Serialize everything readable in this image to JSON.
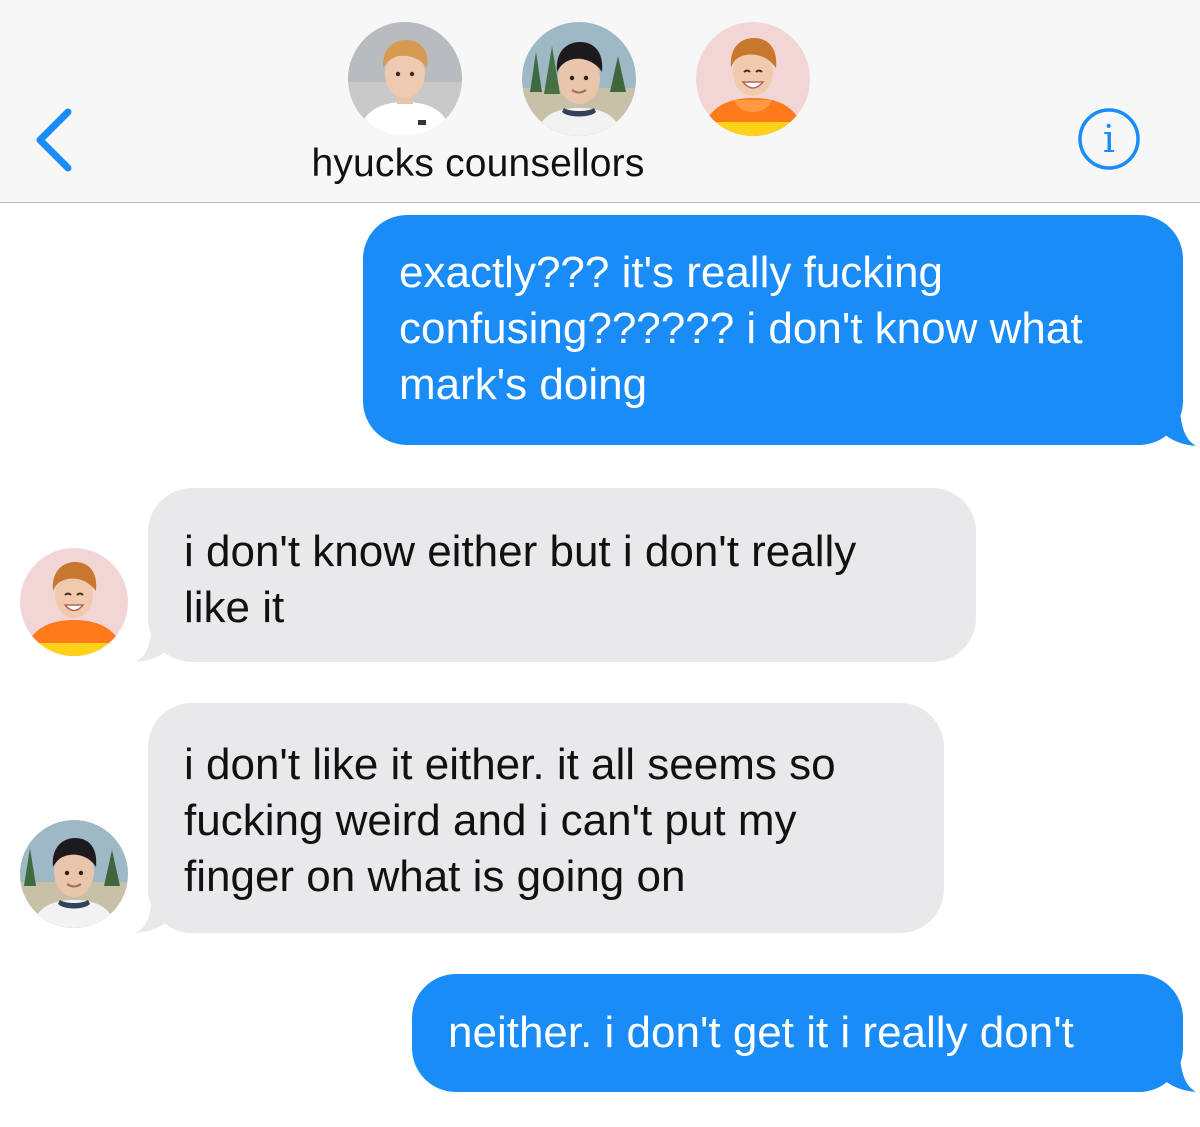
{
  "header": {
    "title": "hyucks counsellors",
    "back_icon": "chevron-left-icon",
    "info_icon": "info-icon",
    "info_glyph": "i",
    "accent_color": "#1a8cf7",
    "participants": [
      {
        "avatar": "participant-avatar-1",
        "shirt_color": "#ffffff"
      },
      {
        "avatar": "participant-avatar-2",
        "shirt_color": "#f0f0f0"
      },
      {
        "avatar": "participant-avatar-3",
        "shirt_color": "#ff7a1a"
      }
    ]
  },
  "messages": [
    {
      "direction": "sent",
      "lines": [
        "exactly??? it's really fucking",
        "confusing?????? i don't know what",
        "mark's doing"
      ]
    },
    {
      "direction": "received",
      "sender_avatar": "orange-hoodie-avatar",
      "lines": [
        "i don't know either but i don't really",
        "like it"
      ]
    },
    {
      "direction": "received",
      "sender_avatar": "beach-avatar",
      "lines": [
        "i don't like it either. it all seems so",
        "fucking weird and i can't put my",
        "finger on what is going on"
      ]
    },
    {
      "direction": "sent",
      "lines": [
        "neither. i don't get it i really don't"
      ]
    }
  ],
  "colors": {
    "sent_bubble": "#1a8cf7",
    "received_bubble": "#e9e9eb",
    "header_bg": "#f7f7f7"
  }
}
